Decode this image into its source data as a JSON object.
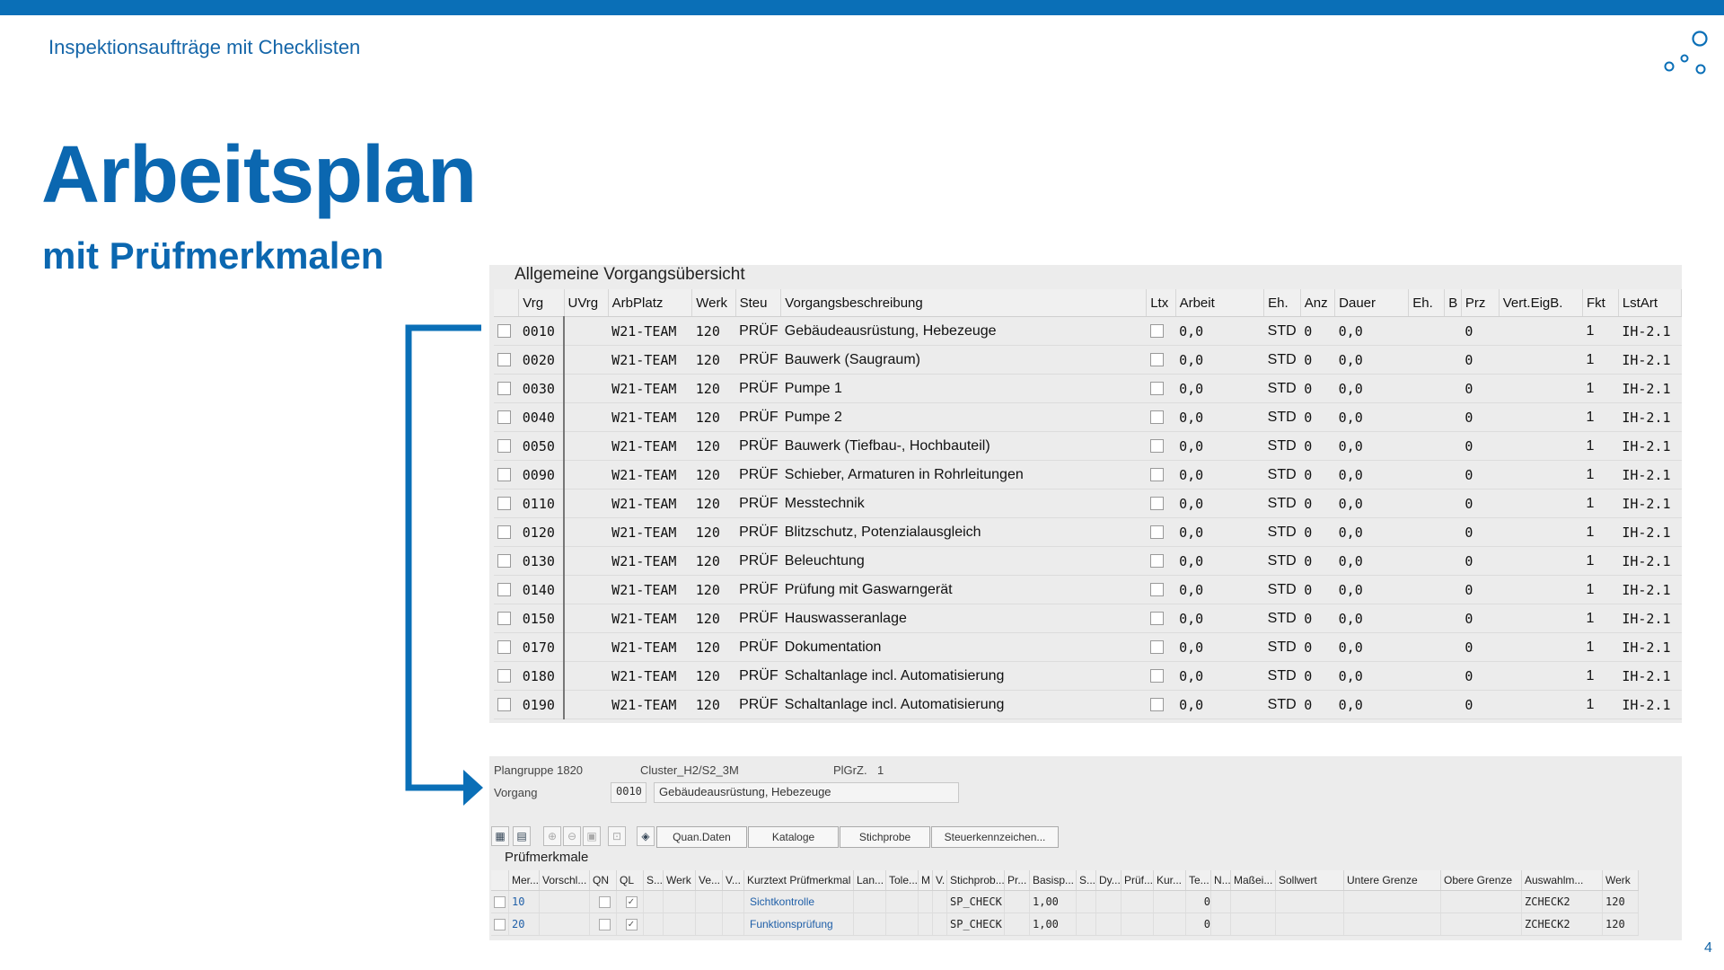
{
  "header": {
    "top_label": "Inspektionsaufträge mit Checklisten",
    "title": "Arbeitsplan",
    "subtitle": "mit Prüfmerkmalen",
    "page_number": "4",
    "brand_color": "#0a6fb7"
  },
  "ops_panel": {
    "title": "Allgemeine Vorgangsübersicht",
    "columns": [
      "Vrg",
      "UVrg",
      "ArbPlatz",
      "Werk",
      "Steu",
      "Vorgangsbeschreibung",
      "Ltx",
      "Arbeit",
      "Eh.",
      "Anz",
      "Dauer",
      "Eh.",
      "B",
      "Prz",
      "Vert.EigB.",
      "Fkt",
      "LstArt"
    ],
    "rows": [
      {
        "vrg": "0010",
        "arbplatz": "W21-TEAM",
        "werk": "120",
        "steu": "PRÜF",
        "desc": "Gebäudeausrüstung, Hebezeuge",
        "arbeit": "0,0",
        "eh": "STD",
        "anz": "0",
        "dauer": "0,0",
        "prz": "0",
        "fkt": "1",
        "lstart": "IH-2.1"
      },
      {
        "vrg": "0020",
        "arbplatz": "W21-TEAM",
        "werk": "120",
        "steu": "PRÜF",
        "desc": "Bauwerk (Saugraum)",
        "arbeit": "0,0",
        "eh": "STD",
        "anz": "0",
        "dauer": "0,0",
        "prz": "0",
        "fkt": "1",
        "lstart": "IH-2.1"
      },
      {
        "vrg": "0030",
        "arbplatz": "W21-TEAM",
        "werk": "120",
        "steu": "PRÜF",
        "desc": "Pumpe 1",
        "arbeit": "0,0",
        "eh": "STD",
        "anz": "0",
        "dauer": "0,0",
        "prz": "0",
        "fkt": "1",
        "lstart": "IH-2.1"
      },
      {
        "vrg": "0040",
        "arbplatz": "W21-TEAM",
        "werk": "120",
        "steu": "PRÜF",
        "desc": "Pumpe 2",
        "arbeit": "0,0",
        "eh": "STD",
        "anz": "0",
        "dauer": "0,0",
        "prz": "0",
        "fkt": "1",
        "lstart": "IH-2.1"
      },
      {
        "vrg": "0050",
        "arbplatz": "W21-TEAM",
        "werk": "120",
        "steu": "PRÜF",
        "desc": "Bauwerk (Tiefbau-, Hochbauteil)",
        "arbeit": "0,0",
        "eh": "STD",
        "anz": "0",
        "dauer": "0,0",
        "prz": "0",
        "fkt": "1",
        "lstart": "IH-2.1"
      },
      {
        "vrg": "0090",
        "arbplatz": "W21-TEAM",
        "werk": "120",
        "steu": "PRÜF",
        "desc": "Schieber, Armaturen in Rohrleitungen",
        "arbeit": "0,0",
        "eh": "STD",
        "anz": "0",
        "dauer": "0,0",
        "prz": "0",
        "fkt": "1",
        "lstart": "IH-2.1"
      },
      {
        "vrg": "0110",
        "arbplatz": "W21-TEAM",
        "werk": "120",
        "steu": "PRÜF",
        "desc": "Messtechnik",
        "arbeit": "0,0",
        "eh": "STD",
        "anz": "0",
        "dauer": "0,0",
        "prz": "0",
        "fkt": "1",
        "lstart": "IH-2.1"
      },
      {
        "vrg": "0120",
        "arbplatz": "W21-TEAM",
        "werk": "120",
        "steu": "PRÜF",
        "desc": "Blitzschutz, Potenzialausgleich",
        "arbeit": "0,0",
        "eh": "STD",
        "anz": "0",
        "dauer": "0,0",
        "prz": "0",
        "fkt": "1",
        "lstart": "IH-2.1"
      },
      {
        "vrg": "0130",
        "arbplatz": "W21-TEAM",
        "werk": "120",
        "steu": "PRÜF",
        "desc": "Beleuchtung",
        "arbeit": "0,0",
        "eh": "STD",
        "anz": "0",
        "dauer": "0,0",
        "prz": "0",
        "fkt": "1",
        "lstart": "IH-2.1"
      },
      {
        "vrg": "0140",
        "arbplatz": "W21-TEAM",
        "werk": "120",
        "steu": "PRÜF",
        "desc": "Prüfung mit Gaswarngerät",
        "arbeit": "0,0",
        "eh": "STD",
        "anz": "0",
        "dauer": "0,0",
        "prz": "0",
        "fkt": "1",
        "lstart": "IH-2.1"
      },
      {
        "vrg": "0150",
        "arbplatz": "W21-TEAM",
        "werk": "120",
        "steu": "PRÜF",
        "desc": "Hauswasseranlage",
        "arbeit": "0,0",
        "eh": "STD",
        "anz": "0",
        "dauer": "0,0",
        "prz": "0",
        "fkt": "1",
        "lstart": "IH-2.1"
      },
      {
        "vrg": "0170",
        "arbplatz": "W21-TEAM",
        "werk": "120",
        "steu": "PRÜF",
        "desc": "Dokumentation",
        "arbeit": "0,0",
        "eh": "STD",
        "anz": "0",
        "dauer": "0,0",
        "prz": "0",
        "fkt": "1",
        "lstart": "IH-2.1"
      },
      {
        "vrg": "0180",
        "arbplatz": "W21-TEAM",
        "werk": "120",
        "steu": "PRÜF",
        "desc": "Schaltanlage incl. Automatisierung",
        "arbeit": "0,0",
        "eh": "STD",
        "anz": "0",
        "dauer": "0,0",
        "prz": "0",
        "fkt": "1",
        "lstart": "IH-2.1"
      },
      {
        "vrg": "0190",
        "arbplatz": "W21-TEAM",
        "werk": "120",
        "steu": "PRÜF",
        "desc": "Schaltanlage incl. Automatisierung",
        "arbeit": "0,0",
        "eh": "STD",
        "anz": "0",
        "dauer": "0,0",
        "prz": "0",
        "fkt": "1",
        "lstart": "IH-2.1"
      }
    ]
  },
  "detail_panel": {
    "plangruppe_label": "Plangruppe 1820",
    "cluster_label": "Cluster_H2/S2_3M",
    "plgrz_label": "PlGrZ.",
    "plgrz_value": "1",
    "vorgang_label": "Vorgang",
    "vorgang_value": "0010",
    "vorgang_desc": "Gebäudeausrüstung, Hebezeuge",
    "buttons": {
      "quan_daten": "Quan.Daten",
      "kataloge": "Kataloge",
      "stichprobe": "Stichprobe",
      "steuerkennzeichen": "Steuerkennzeichen..."
    },
    "section_title": "Prüfmerkmale",
    "columns": [
      "Mer...",
      "Vorschl...",
      "QN",
      "QL",
      "S...",
      "Werk",
      "Ve...",
      "V...",
      "Kurztext Prüfmerkmal",
      "Lan...",
      "Tole...",
      "M",
      "V.",
      "Stichprob...",
      "Pr...",
      "Basisp...",
      "S...",
      "Dy...",
      "Prüf...",
      "Kur...",
      "Te...",
      "N...",
      "Maßei...",
      "Sollwert",
      "Untere Grenze",
      "Obere Grenze",
      "Auswahlm...",
      "Werk"
    ],
    "rows": [
      {
        "mer": "10",
        "text": "Sichtkontrolle",
        "stichprobe": "SP_CHECK",
        "basis": "1,00",
        "te": "0",
        "auswahl": "ZCHECK2",
        "werk": "120"
      },
      {
        "mer": "20",
        "text": "Funktionsprüfung",
        "stichprobe": "SP_CHECK",
        "basis": "1,00",
        "te": "0",
        "auswahl": "ZCHECK2",
        "werk": "120"
      }
    ]
  }
}
